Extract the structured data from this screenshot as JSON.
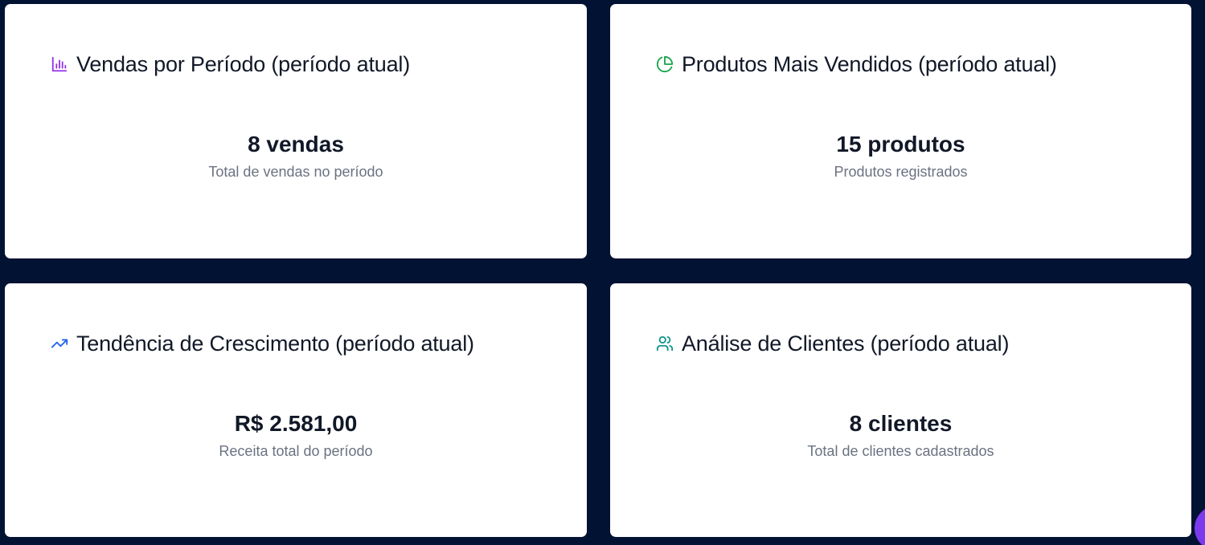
{
  "cards": [
    {
      "icon": "bar-chart-icon",
      "icon_color": "#9333ea",
      "title": "Vendas por Período (período atual)",
      "value": "8 vendas",
      "description": "Total de vendas no período"
    },
    {
      "icon": "pie-chart-icon",
      "icon_color": "#16a34a",
      "title": "Produtos Mais Vendidos (período atual)",
      "value": "15 produtos",
      "description": "Produtos registrados"
    },
    {
      "icon": "trending-up-icon",
      "icon_color": "#2563eb",
      "title": "Tendência de Crescimento (período atual)",
      "value": "R$ 2.581,00",
      "description": "Receita total do período"
    },
    {
      "icon": "users-icon",
      "icon_color": "#0d9488",
      "title": "Análise de Clientes (período atual)",
      "value": "8 clientes",
      "description": "Total de clientes cadastrados"
    }
  ],
  "colors": {
    "background": "#021233",
    "card": "#ffffff",
    "fab": "#7c3aed"
  }
}
